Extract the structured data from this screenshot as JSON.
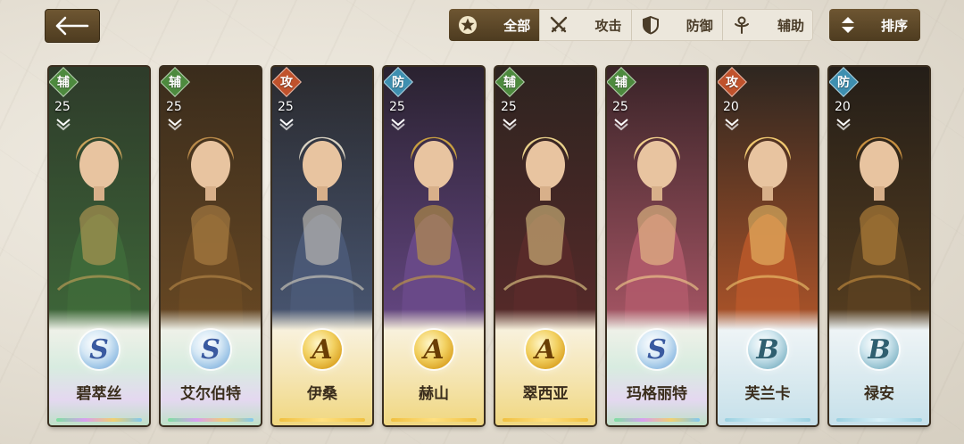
{
  "header": {
    "filters": [
      {
        "label": "全部",
        "icon": "star-icon",
        "active": true
      },
      {
        "label": "攻击",
        "icon": "crossed-swords-icon",
        "active": false
      },
      {
        "label": "防御",
        "icon": "shield-icon",
        "active": false
      },
      {
        "label": "辅助",
        "icon": "support-staff-icon",
        "active": false
      }
    ],
    "sort_label": "排序"
  },
  "heroes": [
    {
      "name": "碧萃丝",
      "role": "辅",
      "level": "25",
      "grade": "S"
    },
    {
      "name": "艾尔伯特",
      "role": "辅",
      "level": "25",
      "grade": "S"
    },
    {
      "name": "伊桑",
      "role": "攻",
      "level": "25",
      "grade": "A"
    },
    {
      "name": "赫山",
      "role": "防",
      "level": "25",
      "grade": "A"
    },
    {
      "name": "翠西亚",
      "role": "辅",
      "level": "25",
      "grade": "A"
    },
    {
      "name": "玛格丽特",
      "role": "辅",
      "level": "25",
      "grade": "S"
    },
    {
      "name": "芙兰卡",
      "role": "攻",
      "level": "20",
      "grade": "B"
    },
    {
      "name": "禄安",
      "role": "防",
      "level": "20",
      "grade": "B"
    }
  ],
  "colors": {
    "role_support": "#4d8a3e",
    "role_attack": "#c0522c",
    "role_defense": "#3e8fb0",
    "frame_brown": "#5a4528"
  }
}
